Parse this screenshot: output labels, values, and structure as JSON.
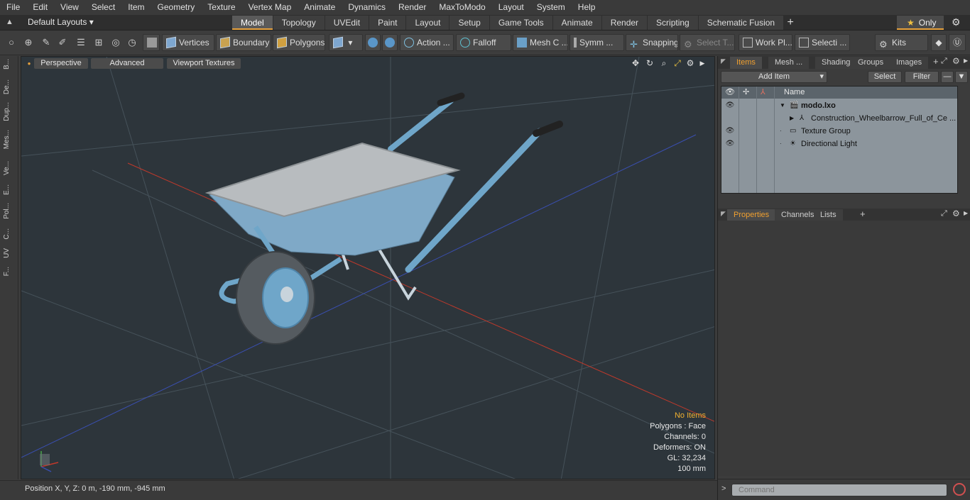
{
  "menu": [
    "File",
    "Edit",
    "View",
    "Select",
    "Item",
    "Geometry",
    "Texture",
    "Vertex Map",
    "Animate",
    "Dynamics",
    "Render",
    "MaxToModo",
    "Layout",
    "System",
    "Help"
  ],
  "layout": {
    "default_layouts": "Default Layouts",
    "tabs": [
      "Model",
      "Topology",
      "UVEdit",
      "Paint",
      "Layout",
      "Setup",
      "Game Tools",
      "Animate",
      "Render",
      "Scripting",
      "Schematic Fusion"
    ],
    "active_tab": "Model",
    "plus": "+",
    "only": "Only"
  },
  "toolbar": {
    "vertices": "Vertices",
    "boundary": "Boundary",
    "polygons": "Polygons",
    "action": "Action",
    "falloff": "Falloff",
    "mesh_c": "Mesh C ...",
    "symm": "Symm ...",
    "snapping": "Snapping",
    "select_t": "Select T...",
    "work_pl": "Work Pl...",
    "selecti": "Selecti ...",
    "kits": "Kits"
  },
  "left_tabs": [
    "B...",
    "De...",
    "Dup...",
    "Mes...",
    "Ve...",
    "E...",
    "Pol...",
    "C...",
    "UV",
    "F..."
  ],
  "viewport": {
    "perspective": "Perspective",
    "advanced": "Advanced",
    "viewport_textures": "Viewport Textures",
    "stats": {
      "no_items": "No Items",
      "polygons": "Polygons : Face",
      "channels": "Channels: 0",
      "deformers": "Deformers: ON",
      "gl": "GL: 32,234",
      "scale": "100 mm"
    },
    "colors": {
      "background": "#2d353b",
      "x_axis": "#c0392b",
      "z_axis": "#3a4fb0",
      "grid": "#46525a",
      "barrow_blue": "#6fa6c9",
      "tray": "#b8bcbf"
    }
  },
  "status": {
    "position": "Position X, Y, Z:   0 m, -190 mm, -945 mm"
  },
  "items_panel": {
    "tabs": [
      "Items",
      "Mesh ...",
      "Shading",
      "Groups",
      "Images"
    ],
    "active_tab": "Items",
    "add_item": "Add Item",
    "select": "Select",
    "filter": "Filter",
    "column_name": "Name",
    "rows": [
      {
        "name": "modo.lxo",
        "eye": true
      },
      {
        "name": "Construction_Wheelbarrow_Full_of_Ce ...",
        "eye": false
      },
      {
        "name": "Texture Group",
        "eye": true
      },
      {
        "name": "Directional Light",
        "eye": true
      }
    ]
  },
  "properties_panel": {
    "tabs": [
      "Properties",
      "Channels",
      "Lists"
    ],
    "active_tab": "Properties"
  },
  "command": {
    "placeholder": "Command"
  }
}
